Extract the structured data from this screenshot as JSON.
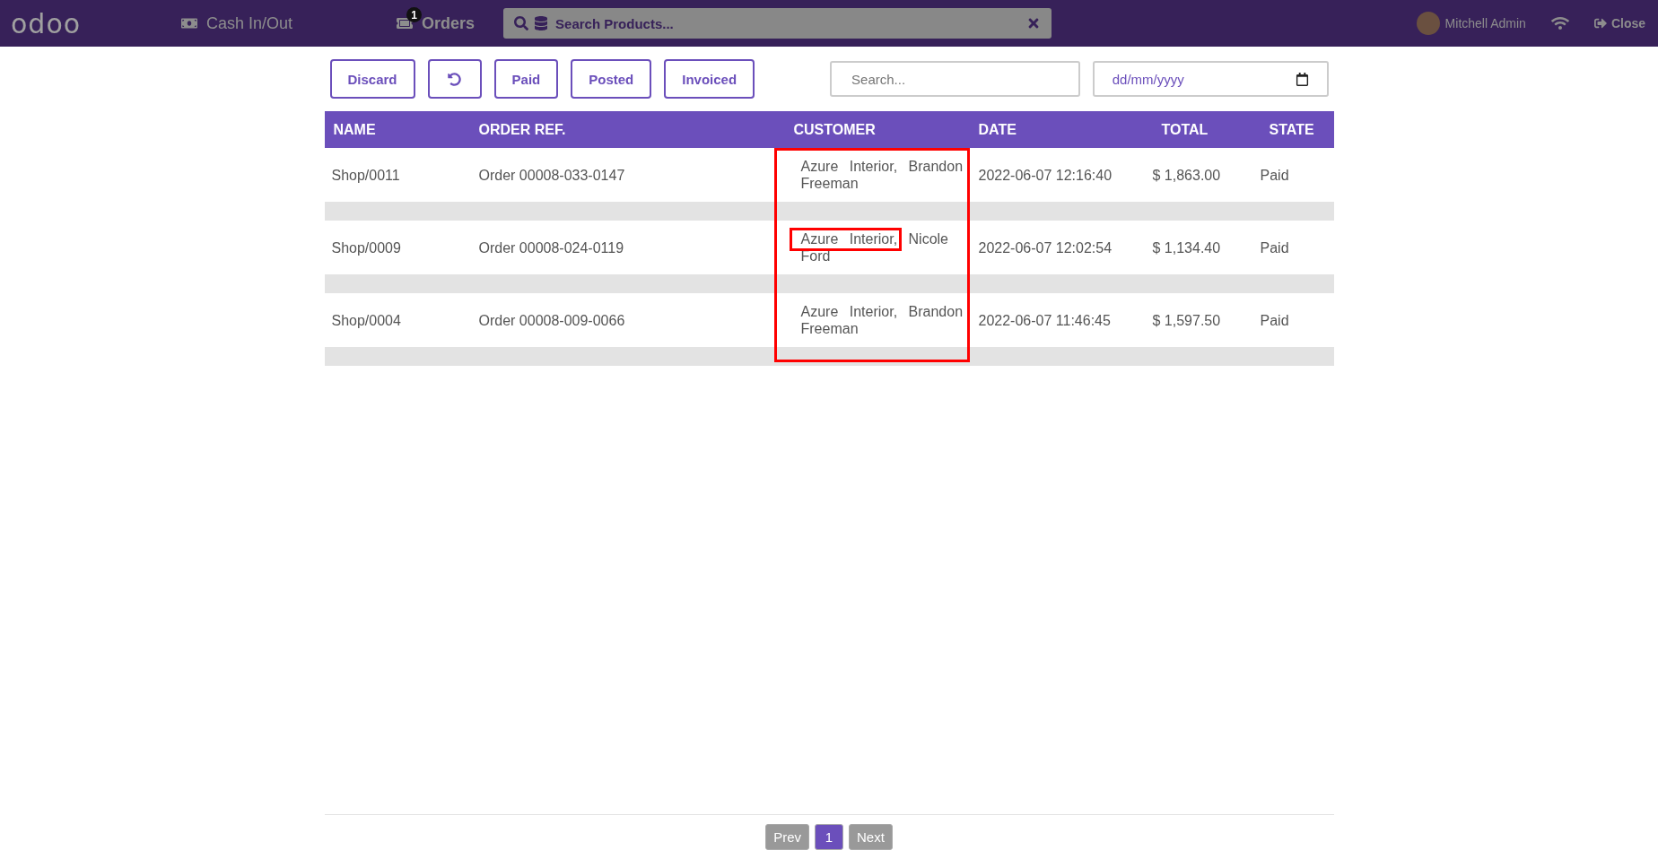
{
  "topbar": {
    "logo": "odoo",
    "cash_button": "Cash In/Out",
    "orders_button": {
      "label": "Orders",
      "badge": "1"
    },
    "search": {
      "placeholder": "Search Products..."
    },
    "user": "Mitchell Admin",
    "close_button": "Close"
  },
  "toolbar": {
    "buttons": [
      {
        "kind": "text",
        "label": "Discard"
      },
      {
        "kind": "back"
      },
      {
        "kind": "text",
        "label": "Paid"
      },
      {
        "kind": "text",
        "label": "Posted"
      },
      {
        "kind": "text",
        "label": "Invoiced"
      }
    ],
    "search": {
      "placeholder": "Search..."
    },
    "date": {
      "placeholder": "dd/mm/yyyy"
    }
  },
  "table": {
    "columns": [
      {
        "label": "NAME",
        "highlighted": false
      },
      {
        "label": "ORDER REF.",
        "highlighted": false
      },
      {
        "label": "CUSTOMER",
        "highlighted": true
      },
      {
        "label": "DATE",
        "highlighted": false
      },
      {
        "label": "TOTAL",
        "highlighted": false
      },
      {
        "label": "STATE",
        "highlighted": false
      }
    ],
    "rows": [
      {
        "cells": [
          "Shop/0011",
          "Order 00008-033-0147",
          "Azure Interior, Brandon Freeman",
          "2022-06-07 12:16:40",
          "$ 1,863.00",
          "Paid"
        ],
        "customer_highlight": false
      },
      {
        "cells": [
          "Shop/0009",
          "Order 00008-024-0119",
          "Azure Interior, Nicole Ford",
          "2022-06-07 12:02:54",
          "$ 1,134.40",
          "Paid"
        ],
        "customer_highlight": true
      },
      {
        "cells": [
          "Shop/0004",
          "Order 00008-009-0066",
          "Azure Interior, Brandon Freeman",
          "2022-06-07 11:46:45",
          "$ 1,597.50",
          "Paid"
        ],
        "customer_highlight": false
      }
    ]
  },
  "pagination": {
    "prev": "Prev",
    "pages": [
      {
        "label": "1",
        "selected": true
      }
    ],
    "next": "Next"
  }
}
